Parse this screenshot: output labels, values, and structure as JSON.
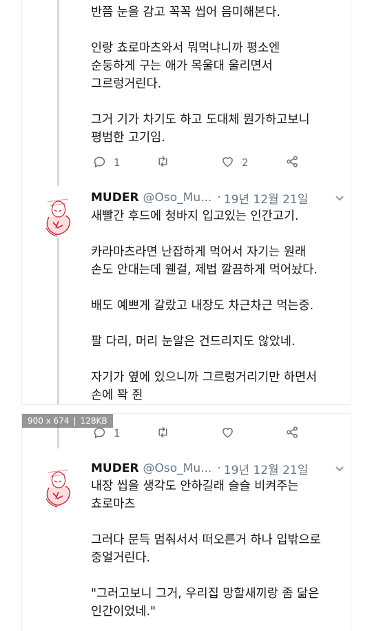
{
  "image_badge": {
    "dimensions": "900 x 674",
    "size": "128KB"
  },
  "tweets": [
    {
      "paragraphs": [
        "반쯤 눈을 감고 꼭꼭 씹어 음미해본다.",
        "인랑 쵸로마츠와서 뭐먹냐니까 평소엔\n순둥하게 구는 애가 목울대 울리면서\n그르렁거린다.",
        "그거 기가 차기도 하고 도대체 뭔가하고보니\n평범한 고기임."
      ],
      "actions": {
        "replies": "1",
        "retweets": "",
        "likes": "2"
      }
    },
    {
      "author": "MUDER",
      "handle": "@Oso_Mu...",
      "dot": "·",
      "date": "19년 12월 21일",
      "paragraphs": [
        "새빨간 후드에 청바지 입고있는 인간고기.",
        "카라마츠라면 난잡하게 먹어서 자기는 원래\n손도 안대는데 웬걸, 제법 깔끔하게 먹어놨다.",
        "배도 예쁘게 갈랐고 내장도 차근차근 먹는중.",
        "팔 다리, 머리 눈알은 건드리지도 않았네.",
        "자기가 옆에 있으니까 그르렁거리기만 하면서\n손에 꽉 쥔"
      ],
      "actions": {
        "replies": "1",
        "retweets": "",
        "likes": ""
      }
    },
    {
      "author": "MUDER",
      "handle": "@Oso_Mu...",
      "dot": "·",
      "date": "19년 12월 21일",
      "paragraphs": [
        "내장 씹을 생각도 안하길래 슬슬 비켜주는\n쵸로마츠",
        "그러다 문득 멈춰서서 떠오른거 하나 입밖으로\n중얼거린다.",
        "\"그러고보니 그거, 우리집 망할새끼랑 좀 닮은\n인간이었네.\""
      ]
    }
  ]
}
